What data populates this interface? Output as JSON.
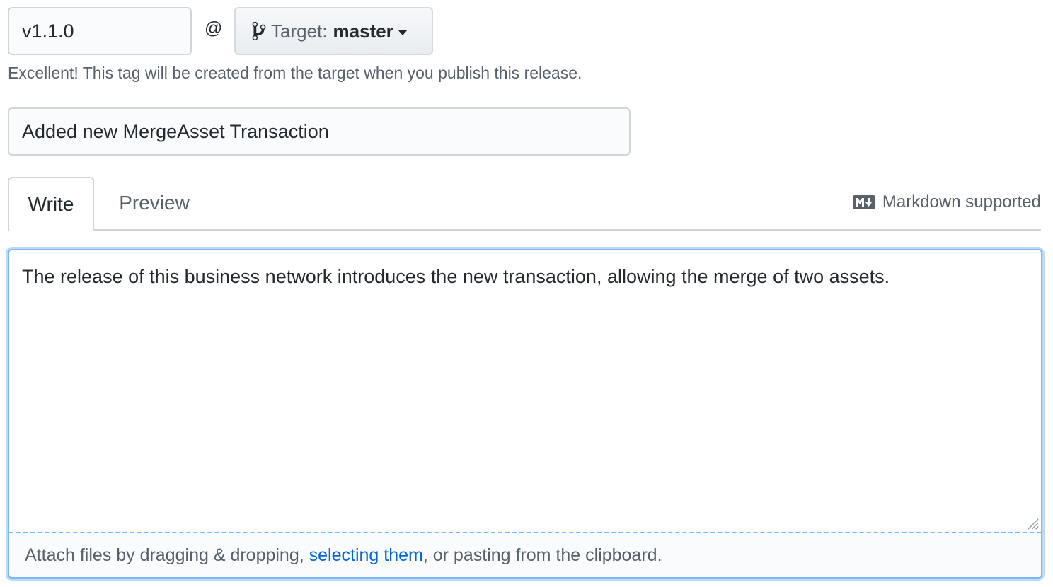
{
  "tag": {
    "value": "v1.1.0",
    "separator": "@"
  },
  "target": {
    "label": "Target:",
    "branch": "master"
  },
  "hint": "Excellent! This tag will be created from the target when you publish this release.",
  "release_title": {
    "value": "Added new MergeAsset Transaction"
  },
  "tabs": [
    {
      "label": "Write",
      "active": true
    },
    {
      "label": "Preview",
      "active": false
    }
  ],
  "markdown_note": "Markdown supported",
  "body": {
    "value": "The release of this business network introduces the new transaction, allowing the merge of two assets."
  },
  "attach": {
    "prefix": "Attach files by dragging & dropping, ",
    "link": "selecting them",
    "suffix": ", or pasting from the clipboard."
  },
  "colors": {
    "link": "#0366d6",
    "focus_border": "#79b8ff",
    "muted_text": "#586069"
  }
}
